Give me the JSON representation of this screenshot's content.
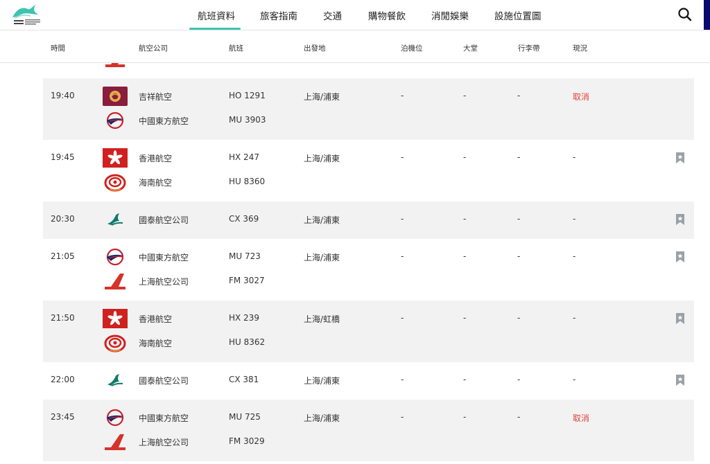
{
  "nav": {
    "items": [
      "航班資料",
      "旅客指南",
      "交通",
      "購物餐飲",
      "消閒娛樂",
      "設施位置圖"
    ],
    "active_index": 0
  },
  "header": {
    "columns": [
      "時間",
      "航空公司",
      "航班",
      "出發地",
      "泊機位",
      "大堂",
      "行李帶",
      "現況"
    ]
  },
  "icons": {
    "logo": "airport-logo",
    "search": "search-icon",
    "bookmark": "bookmark-icon"
  },
  "colors": {
    "accent": "#3ec3b2",
    "cancel": "#e2403a",
    "row_shade": "#f2f2f2",
    "bookmark": "#9aa0a6"
  },
  "flights": [
    {
      "time": "19:40",
      "airlines": [
        {
          "name": "吉祥航空",
          "flight": "HO 1291",
          "logo": "juneyao-logo"
        },
        {
          "name": "中國東方航空",
          "flight": "MU 3903",
          "logo": "china-eastern-logo"
        }
      ],
      "origin": "上海/浦東",
      "stand": "-",
      "hall": "-",
      "belt": "-",
      "status": "取消",
      "cancelled": true,
      "bookmark": false
    },
    {
      "time": "19:45",
      "airlines": [
        {
          "name": "香港航空",
          "flight": "HX 247",
          "logo": "hong-kong-airlines-logo"
        },
        {
          "name": "海南航空",
          "flight": "HU 8360",
          "logo": "hainan-airlines-logo"
        }
      ],
      "origin": "上海/浦東",
      "stand": "-",
      "hall": "-",
      "belt": "-",
      "status": "-",
      "cancelled": false,
      "bookmark": true
    },
    {
      "time": "20:30",
      "airlines": [
        {
          "name": "國泰航空公司",
          "flight": "CX 369",
          "logo": "cathay-pacific-logo"
        }
      ],
      "origin": "上海/浦東",
      "stand": "-",
      "hall": "-",
      "belt": "-",
      "status": "-",
      "cancelled": false,
      "bookmark": true
    },
    {
      "time": "21:05",
      "airlines": [
        {
          "name": "中國東方航空",
          "flight": "MU 723",
          "logo": "china-eastern-logo"
        },
        {
          "name": "上海航空公司",
          "flight": "FM 3027",
          "logo": "shanghai-airlines-logo"
        }
      ],
      "origin": "上海/浦東",
      "stand": "-",
      "hall": "-",
      "belt": "-",
      "status": "-",
      "cancelled": false,
      "bookmark": true
    },
    {
      "time": "21:50",
      "airlines": [
        {
          "name": "香港航空",
          "flight": "HX 239",
          "logo": "hong-kong-airlines-logo"
        },
        {
          "name": "海南航空",
          "flight": "HU 8362",
          "logo": "hainan-airlines-logo"
        }
      ],
      "origin": "上海/虹橋",
      "stand": "-",
      "hall": "-",
      "belt": "-",
      "status": "-",
      "cancelled": false,
      "bookmark": true
    },
    {
      "time": "22:00",
      "airlines": [
        {
          "name": "國泰航空公司",
          "flight": "CX 381",
          "logo": "cathay-pacific-logo"
        }
      ],
      "origin": "上海/浦東",
      "stand": "-",
      "hall": "-",
      "belt": "-",
      "status": "-",
      "cancelled": false,
      "bookmark": true
    },
    {
      "time": "23:45",
      "airlines": [
        {
          "name": "中國東方航空",
          "flight": "MU 725",
          "logo": "china-eastern-logo"
        },
        {
          "name": "上海航空公司",
          "flight": "FM 3029",
          "logo": "shanghai-airlines-logo"
        }
      ],
      "origin": "上海/浦東",
      "stand": "-",
      "hall": "-",
      "belt": "-",
      "status": "取消",
      "cancelled": true,
      "bookmark": false
    }
  ]
}
